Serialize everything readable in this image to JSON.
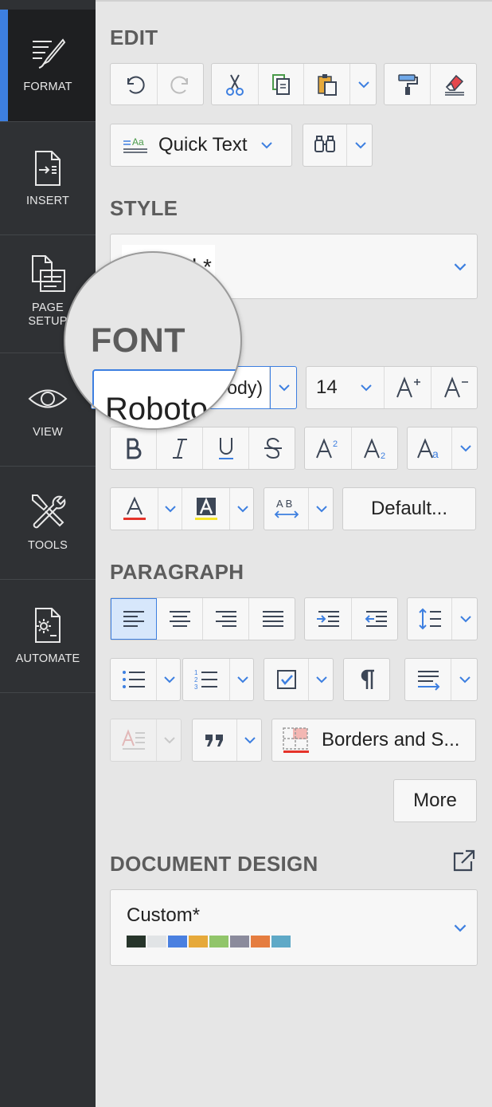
{
  "sidebar": {
    "items": [
      {
        "label": "FORMAT",
        "icon": "format-brush-icon",
        "active": true
      },
      {
        "label": "INSERT",
        "icon": "insert-document-icon"
      },
      {
        "label": "PAGE\nSETUP",
        "icon": "page-setup-icon"
      },
      {
        "label": "VIEW",
        "icon": "eye-icon"
      },
      {
        "label": "TOOLS",
        "icon": "tools-icon"
      },
      {
        "label": "AUTOMATE",
        "icon": "automate-gear-icon"
      }
    ]
  },
  "edit": {
    "title": "EDIT",
    "quick_text_label": "Quick Text"
  },
  "style": {
    "title": "STYLE",
    "selected_value": "Normal *"
  },
  "font": {
    "title": "FONT",
    "family_value": "Roboto (Body)",
    "size_value": "14",
    "default_label": "Default..."
  },
  "paragraph": {
    "title": "PARAGRAPH",
    "borders_label": "Borders and S...",
    "more_label": "More"
  },
  "document_design": {
    "title": "DOCUMENT DESIGN",
    "theme_value": "Custom*",
    "swatches": [
      "#27352b",
      "#e1e4e6",
      "#4a80e0",
      "#e6a93a",
      "#91c56a",
      "#8b8b9c",
      "#e57d40",
      "#5fa9c7"
    ]
  },
  "colors": {
    "accent": "#3d7fe0",
    "sidebar_bg": "#2f3134",
    "panel_bg": "#e6e6e6",
    "icon_color": "#3c4656"
  }
}
